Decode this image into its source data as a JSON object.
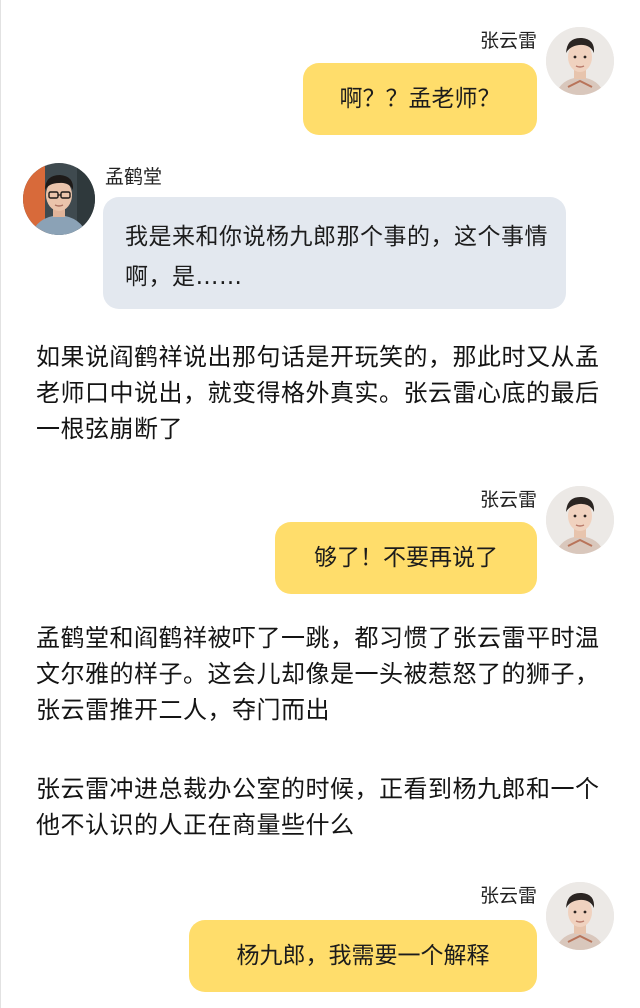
{
  "characters": {
    "zhang": {
      "name": "张云雷",
      "avatar_icon": "young-man-portrait-icon"
    },
    "meng": {
      "name": "孟鹤堂",
      "avatar_icon": "man-with-glasses-portrait-icon"
    }
  },
  "colors": {
    "yellow_bubble": "#ffdd6b",
    "gray_bubble": "#e3e8ef",
    "background": "#ffffff"
  },
  "messages": [
    {
      "speaker": "张云雷",
      "text": "啊？？孟老师？"
    },
    {
      "speaker": "孟鹤堂",
      "text": "我是来和你说杨九郎那个事的，这个事情啊，是……"
    },
    {
      "speaker": "张云雷",
      "text": "够了！不要再说了"
    },
    {
      "speaker": "张云雷",
      "text": "杨九郎，我需要一个解释"
    }
  ],
  "narration": [
    "如果说阎鹤祥说出那句话是开玩笑的，那此时又从孟老师口中说出，就变得格外真实。张云雷心底的最后一根弦崩断了",
    "孟鹤堂和阎鹤祥被吓了一跳，都习惯了张云雷平时温文尔雅的样子。这会儿却像是一头被惹怒了的狮子，张云雷推开二人，夺门而出",
    "张云雷冲进总裁办公室的时候，正看到杨九郎和一个他不认识的人正在商量些什么"
  ]
}
